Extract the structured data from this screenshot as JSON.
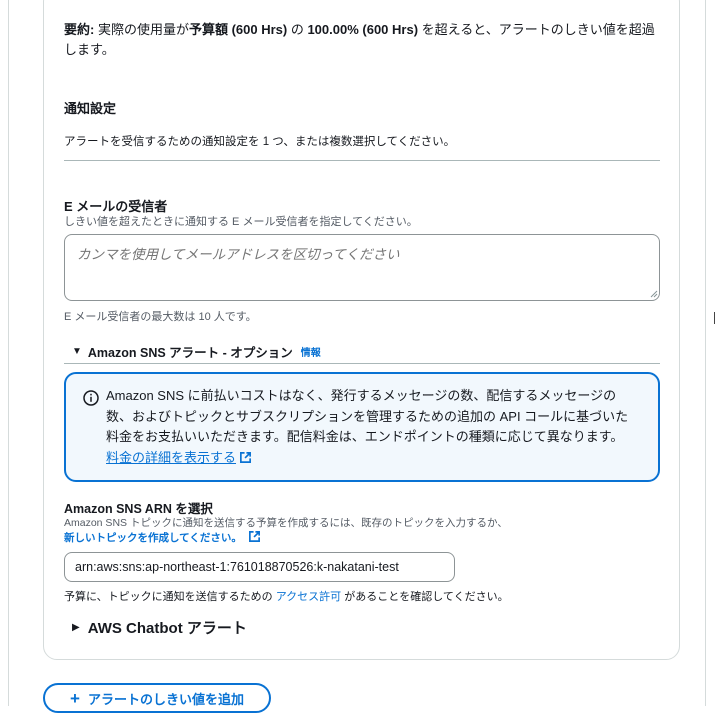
{
  "summary": {
    "label": "要約:",
    "text1": " 実際の使用量が",
    "budget_label": "予算額 (600 Hrs)",
    "text2": " の ",
    "threshold": "100.00% (600 Hrs)",
    "text3": " を超えると、アラートのしきい値を超過します。"
  },
  "notification": {
    "title": "通知設定",
    "description": "アラートを受信するための通知設定を 1 つ、または複数選択してください。"
  },
  "email": {
    "title": "E メールの受信者",
    "description": "しきい値を超えたときに通知する E メール受信者を指定してください。",
    "placeholder": "カンマを使用してメールアドレスを区切ってください",
    "limit": "E メール受信者の最大数は 10 人です。"
  },
  "sns": {
    "section_title": "Amazon SNS アラート - オプション",
    "info": "情報",
    "alert_text": "Amazon SNS に前払いコストはなく、発行するメッセージの数、配信するメッセージの数、およびトピックとサブスクリプションを管理するための追加の API コールに基づいた料金をお支払いいただきます。配信料金は、エンドポイントの種類に応じて異なります。",
    "pricing_link": "料金の詳細を表示する",
    "arn_title": "Amazon SNS ARN を選択",
    "arn_desc": "Amazon SNS トピックに通知を送信する予算を作成するには、既存のトピックを入力するか、",
    "create_topic_link": "新しいトピックを作成してください。",
    "arn_value": "arn:aws:sns:ap-northeast-1:761018870526:k-nakatani-test",
    "confirm_pre": "予算に、トピックに通知を送信するための ",
    "access_link": "アクセス許可",
    "confirm_post": " があることを確認してください。"
  },
  "chatbot": {
    "title": "AWS Chatbot アラート"
  },
  "add_threshold": {
    "label": "アラートのしきい値を追加"
  },
  "colors": {
    "link": "#0972d3",
    "alert_bg": "#f2f8fd",
    "border": "#d5dbdb"
  },
  "icons": [
    "info-icon",
    "external-link-icon",
    "caret-down-icon",
    "caret-right-icon",
    "plus-icon",
    "resize-grip-icon"
  ]
}
